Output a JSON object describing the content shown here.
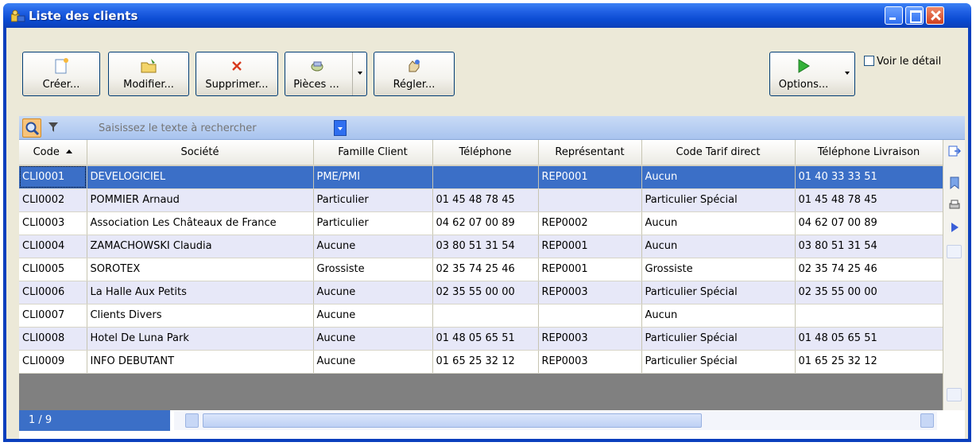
{
  "window": {
    "title": "Liste des clients",
    "icon": "people-icon"
  },
  "toolbar": {
    "create_label": "Créer...",
    "modify_label": "Modifier...",
    "delete_label": "Supprimer...",
    "pieces_label": "Pièces ...",
    "settings_label": "Régler...",
    "options_label": "Options..."
  },
  "detail_toggle": {
    "label": "Voir le détail",
    "checked": false
  },
  "search": {
    "placeholder": "Saisissez le texte à rechercher"
  },
  "table": {
    "columns": [
      "Code",
      "Société",
      "Famille Client",
      "Téléphone",
      "Représentant",
      "Code Tarif direct",
      "Téléphone Livraison"
    ],
    "sorted_column": "Code",
    "rows": [
      [
        "CLI0001",
        "DEVELOGICIEL",
        "PME/PMI",
        "",
        "REP0001",
        "Aucun",
        "01 40 33 33 51"
      ],
      [
        "CLI0002",
        "POMMIER Arnaud",
        "Particulier",
        "01 45 48 78 45",
        "",
        "Particulier Spécial",
        "01 45 48 78 45"
      ],
      [
        "CLI0003",
        "Association Les Châteaux de France",
        "Particulier",
        "04 62 07 00 89",
        "REP0002",
        "Aucun",
        "04 62 07 00 89"
      ],
      [
        "CLI0004",
        "ZAMACHOWSKI Claudia",
        "Aucune",
        "03 80 51 31 54",
        "REP0001",
        "Aucun",
        "03 80 51 31 54"
      ],
      [
        "CLI0005",
        "SOROTEX",
        "Grossiste",
        "02 35 74 25 46",
        "REP0001",
        "Grossiste",
        "02 35 74 25 46"
      ],
      [
        "CLI0006",
        "La Halle Aux Petits",
        "Aucune",
        "02 35 55 00 00",
        "REP0003",
        "Particulier Spécial",
        "02 35 55 00 00"
      ],
      [
        "CLI0007",
        "Clients Divers",
        "Aucune",
        "",
        "",
        "Aucun",
        ""
      ],
      [
        "CLI0008",
        "Hotel De Luna Park",
        "Aucune",
        "01 48 05 65 51",
        "REP0003",
        "Particulier Spécial",
        "01 48 05 65 51"
      ],
      [
        "CLI0009",
        "INFO DEBUTANT",
        "Aucune",
        "01 65 25 32 12",
        "REP0003",
        "Particulier Spécial",
        "01 65 25 32 12"
      ]
    ],
    "selected_row": 0
  },
  "status": {
    "record_count": "1 / 9"
  },
  "colors": {
    "title_bar": "#1f5fe3",
    "selection": "#3b6fc7",
    "alt_row": "#e7e8f8"
  }
}
